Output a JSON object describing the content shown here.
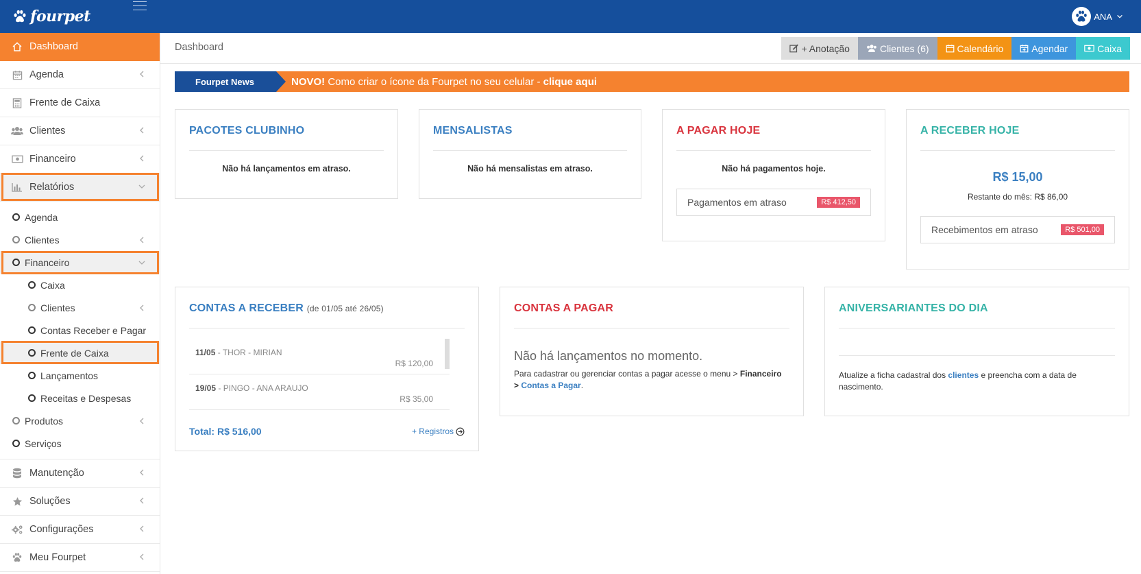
{
  "app": {
    "logo_text": "fourpet",
    "user_name": "ANA"
  },
  "colors": {
    "brand": "#154f9c",
    "accent": "#f5822f",
    "blue": "#3a7fc1",
    "red": "#d9343e",
    "teal": "#36b3a7"
  },
  "sidebar": {
    "dashboard": "Dashboard",
    "agenda": "Agenda",
    "frente_caixa": "Frente de Caixa",
    "clientes": "Clientes",
    "financeiro": "Financeiro",
    "relatorios": "Relatórios",
    "sub": {
      "agenda": "Agenda",
      "clientes": "Clientes",
      "financeiro": "Financeiro",
      "caixa": "Caixa",
      "fin_clientes": "Clientes",
      "contas": "Contas Receber e Pagar",
      "frente_caixa": "Frente de Caixa",
      "lancamentos": "Lançamentos",
      "receitas": "Receitas e Despesas",
      "produtos": "Produtos",
      "servicos": "Serviços"
    },
    "manutencao": "Manutenção",
    "solucoes": "Soluções",
    "configuracoes": "Configurações",
    "meu_fourpet": "Meu Fourpet"
  },
  "header": {
    "breadcrumb": "Dashboard",
    "btn_anotacao": "+ Anotação",
    "btn_clientes": "Clientes (6)",
    "btn_calendario": "Calendário",
    "btn_agendar": "Agendar",
    "btn_caixa": "Caixa"
  },
  "news": {
    "tag": "Fourpet News",
    "novo": "NOVO!",
    "text": " Como criar o ícone da Fourpet no seu celular - ",
    "link": "clique aqui"
  },
  "cards": {
    "pacotes": {
      "title": "PACOTES CLUBINHO",
      "empty": "Não há lançamentos em atraso."
    },
    "mensalistas": {
      "title": "MENSALISTAS",
      "empty": "Não há mensalistas em atraso."
    },
    "a_pagar": {
      "title": "A PAGAR HOJE",
      "empty": "Não há pagamentos hoje.",
      "overdue_label": "Pagamentos em atraso",
      "overdue_value": "R$ 412,50"
    },
    "a_receber": {
      "title": "A RECEBER HOJE",
      "amount": "R$ 15,00",
      "restante": "Restante do mês: R$ 86,00",
      "overdue_label": "Recebimentos em atraso",
      "overdue_value": "R$ 501,00"
    },
    "contas_receber": {
      "title": "CONTAS A RECEBER",
      "period": "(de 01/05 até 26/05)",
      "rows": [
        {
          "date": "11/05",
          "desc": " - THOR - MIRIAN",
          "amount": "R$ 120,00"
        },
        {
          "date": "19/05",
          "desc": " - PINGO - ANA ARAUJO",
          "amount": "R$ 35,00"
        }
      ],
      "total": "Total: R$ 516,00",
      "more": "+ Registros"
    },
    "contas_pagar": {
      "title": "CONTAS A PAGAR",
      "message": "Não há lançamentos no momento.",
      "info_1": "Para cadastrar ou gerenciar contas a pagar acesse o menu > ",
      "info_menu": "Financeiro",
      "info_2": "> ",
      "info_link": "Contas a Pagar",
      "info_3": "."
    },
    "aniversariantes": {
      "title": "ANIVERSARIANTES DO DIA",
      "info_1": "Atualize a ficha cadastral dos ",
      "info_link": "clientes",
      "info_2": " e preencha com a data de nascimento."
    }
  }
}
